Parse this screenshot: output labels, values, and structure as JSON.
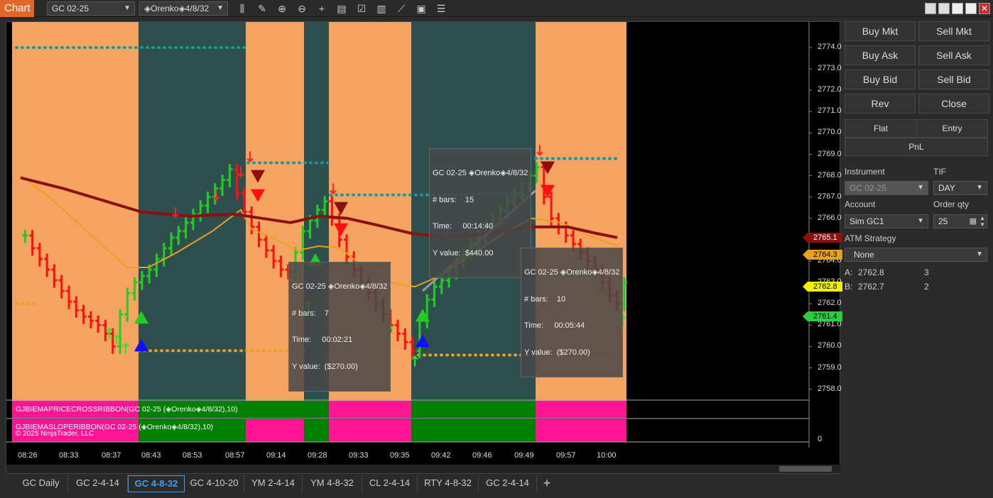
{
  "toolbar": {
    "tab_label": "Chart",
    "instrument": "GC 02-25",
    "bar_type": "◈Orenko◈4/8/32"
  },
  "chart": {
    "price_ticks": [
      "2774.0",
      "2773.0",
      "2772.0",
      "2771.0",
      "2770.0",
      "2769.0",
      "2768.0",
      "2767.0",
      "2766.0",
      "2765.0",
      "2764.0",
      "2763.0",
      "2762.0",
      "2761.0",
      "2760.0",
      "2759.0",
      "2758.0"
    ],
    "zero_label": "0",
    "time_ticks": [
      "08:26",
      "08:33",
      "08:37",
      "08:43",
      "08:53",
      "08:57",
      "09:14",
      "09:28",
      "09:33",
      "09:35",
      "09:42",
      "09:46",
      "09:49",
      "09:57",
      "10:00"
    ],
    "tags": [
      {
        "value": "2765.1",
        "color": "#8b1010",
        "text_color": "#fff"
      },
      {
        "value": "2764.3",
        "color": "#e8a020",
        "text_color": "#000"
      },
      {
        "value": "2762.8",
        "color": "#f0f000",
        "text_color": "#000"
      },
      {
        "value": "2761.4",
        "color": "#2ecc40",
        "text_color": "#000"
      }
    ],
    "tooltips": [
      {
        "title": "GC 02-25 ◈Orenko◈4/8/32",
        "bars_label": "# bars:",
        "bars": "7",
        "time_label": "Time:",
        "time": "00:02:21",
        "y_label": "Y value:",
        "y": "($270.00)"
      },
      {
        "title": "GC 02-25 ◈Orenko◈4/8/32",
        "bars_label": "# bars:",
        "bars": "15",
        "time_label": "Time:",
        "time": "00:14:40",
        "y_label": "Y value:",
        "y": "$440.00"
      },
      {
        "title": "GC 02-25 ◈Orenko◈4/8/32",
        "bars_label": "# bars:",
        "bars": "10",
        "time_label": "Time:",
        "time": "00:05:44",
        "y_label": "Y value:",
        "y": "($270.00)"
      }
    ],
    "ribbon1_label": "GJBIEMAPRICECROSSRIBBON(GC 02-25 (◈Orenko◈4/8/32),10)",
    "ribbon2_label": "GJBIEMASLOPERIBBON(GC 02-25 (◈Orenko◈4/8/32),10)",
    "copyright": "© 2025 NinjaTrader, LLC",
    "colors": {
      "orange": "#f4a460",
      "teal": "#2f4f4f",
      "up": "#22cc22",
      "down": "#ff1010",
      "magenta": "#ff1493",
      "green": "#008000"
    }
  },
  "tabs": [
    {
      "label": "GC Daily"
    },
    {
      "label": "GC 2-4-14"
    },
    {
      "label": "GC 4-8-32"
    },
    {
      "label": "GC 4-10-20"
    },
    {
      "label": "YM 2-4-14"
    },
    {
      "label": "YM 4-8-32"
    },
    {
      "label": "CL 2-4-14"
    },
    {
      "label": "RTY 4-8-32"
    },
    {
      "label": "GC 2-4-14"
    },
    {
      "label": "+"
    }
  ],
  "panel": {
    "buy_mkt": "Buy Mkt",
    "sell_mkt": "Sell Mkt",
    "buy_ask": "Buy Ask",
    "sell_ask": "Sell Ask",
    "buy_bid": "Buy Bid",
    "sell_bid": "Sell Bid",
    "rev": "Rev",
    "close": "Close",
    "flat": "Flat",
    "entry": "Entry",
    "pnl": "PnL",
    "instrument_label": "Instrument",
    "instrument_value": "GC 02-25",
    "tif_label": "TIF",
    "tif_value": "DAY",
    "account_label": "Account",
    "account_value": "Sim GC1",
    "qty_label": "Order qty",
    "qty_value": "25",
    "atm_label": "ATM Strategy",
    "atm_value": "None",
    "ask_label": "A:",
    "ask_price": "2762.8",
    "ask_size": "3",
    "bid_label": "B:",
    "bid_price": "2762.7",
    "bid_size": "2"
  }
}
